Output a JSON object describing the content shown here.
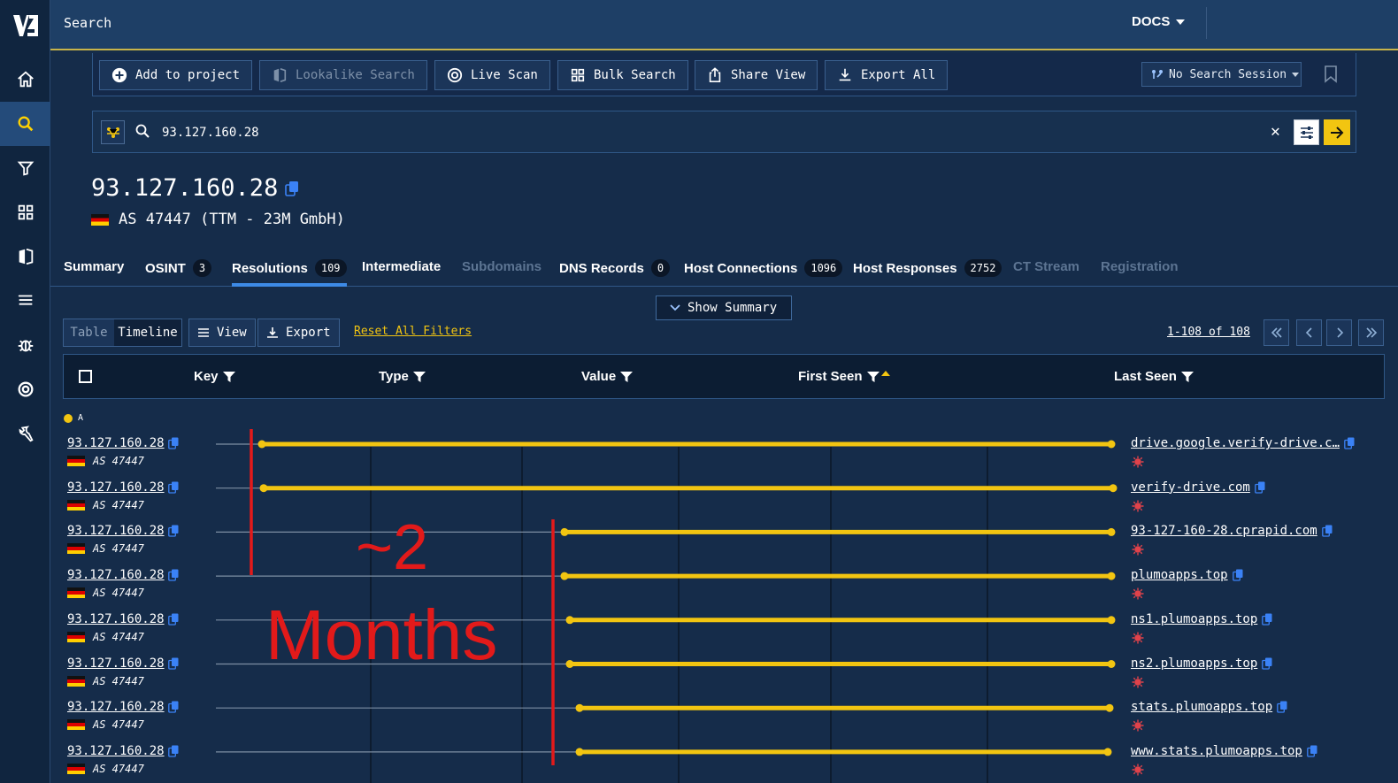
{
  "header": {
    "title": "Search",
    "docs_label": "DOCS"
  },
  "toolbar": {
    "add_to_project": "Add to project",
    "lookalike_search": "Lookalike Search",
    "live_scan": "Live Scan",
    "bulk_search": "Bulk Search",
    "share_view": "Share View",
    "export_all": "Export All",
    "session": "No Search Session"
  },
  "search": {
    "value": "93.127.160.28"
  },
  "host": {
    "ip": "93.127.160.28",
    "asn": "AS 47447 (TTM - 23M GmbH)"
  },
  "tabs": [
    {
      "label": "Summary",
      "count": ""
    },
    {
      "label": "OSINT",
      "count": "3"
    },
    {
      "label": "Resolutions",
      "count": "109"
    },
    {
      "label": "Intermediate",
      "count": ""
    },
    {
      "label": "Subdomains",
      "count": ""
    },
    {
      "label": "DNS Records",
      "count": "0"
    },
    {
      "label": "Host Connections",
      "count": "1096"
    },
    {
      "label": "Host Responses",
      "count": "2752"
    },
    {
      "label": "CT Stream",
      "count": ""
    },
    {
      "label": "Registration",
      "count": ""
    }
  ],
  "controls": {
    "show_summary": "Show Summary",
    "view_table": "Table",
    "view_timeline": "Timeline",
    "view": "View",
    "export": "Export",
    "reset_filters": "Reset All Filters",
    "pager": "1-108 of 108"
  },
  "columns": [
    "Key",
    "Type",
    "Value",
    "First Seen",
    "Last Seen"
  ],
  "legend": {
    "label": "A",
    "color": "#f2c511"
  },
  "rows": [
    {
      "key": "93.127.160.28",
      "asn": "AS 47447",
      "value": "drive.google.verify-drive.c…"
    },
    {
      "key": "93.127.160.28",
      "asn": "AS 47447",
      "value": "verify-drive.com"
    },
    {
      "key": "93.127.160.28",
      "asn": "AS 47447",
      "value": "93-127-160-28.cprapid.com"
    },
    {
      "key": "93.127.160.28",
      "asn": "AS 47447",
      "value": "plumoapps.top"
    },
    {
      "key": "93.127.160.28",
      "asn": "AS 47447",
      "value": "ns1.plumoapps.top"
    },
    {
      "key": "93.127.160.28",
      "asn": "AS 47447",
      "value": "ns2.plumoapps.top"
    },
    {
      "key": "93.127.160.28",
      "asn": "AS 47447",
      "value": "stats.plumoapps.top"
    },
    {
      "key": "93.127.160.28",
      "asn": "AS 47447",
      "value": "www.stats.plumoapps.top"
    }
  ],
  "annotation": {
    "line1": "~2",
    "line2": "Months",
    "color": "#e21a1a"
  },
  "colors": {
    "accent": "#f2c511",
    "tab_active": "#3d8ae6",
    "background": "#152c4a"
  }
}
